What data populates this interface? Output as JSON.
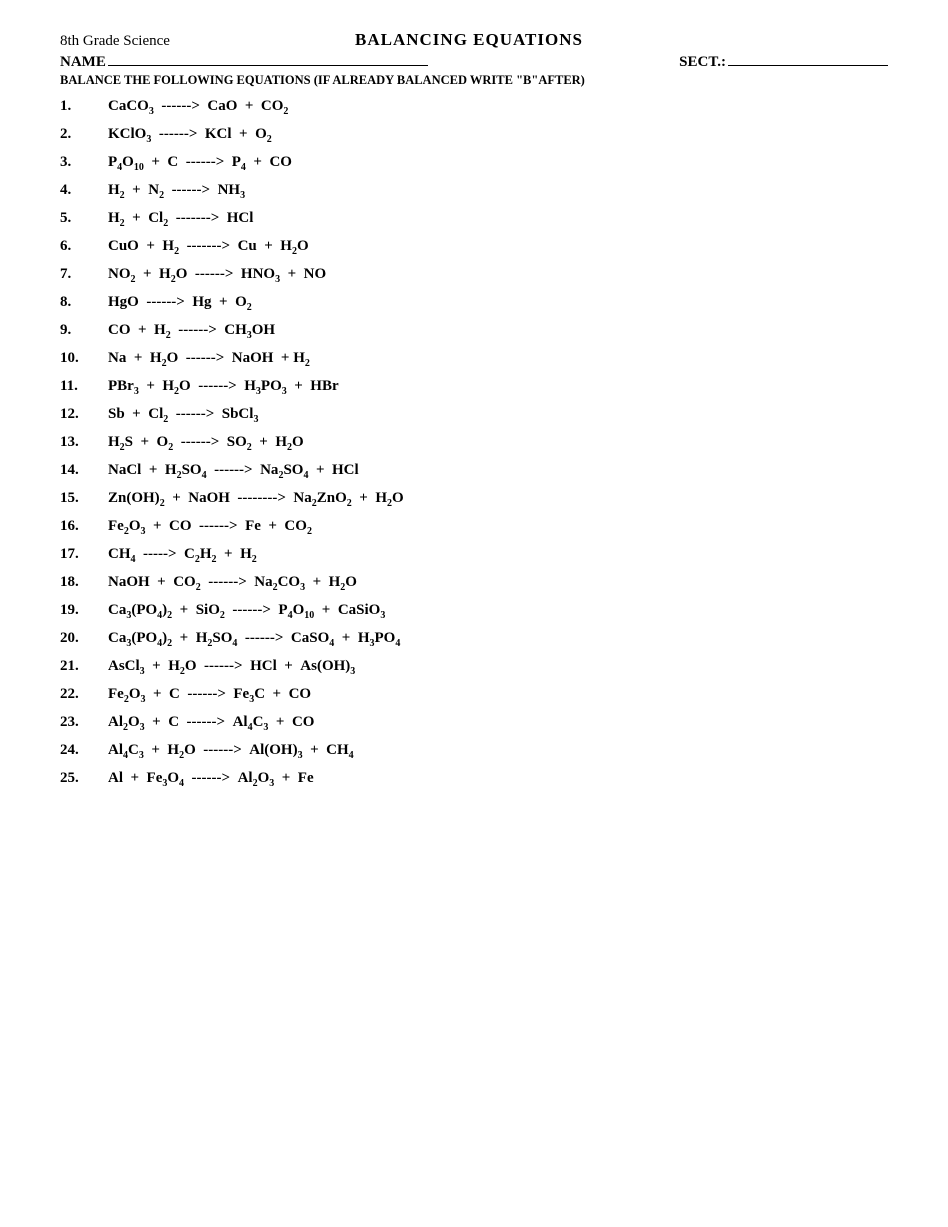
{
  "header": {
    "subject": "8th Grade Science",
    "title": "BALANCING EQUATIONS"
  },
  "form": {
    "name_label": "NAME",
    "sect_label": "SECT.:",
    "instruction": "BALANCE THE FOLLOWING EQUATIONS (IF ALREADY BALANCED WRITE \"B\"AFTER)"
  },
  "equations": [
    {
      "num": "1.",
      "html": "CaCO<sub>3</sub> &nbsp;------&gt; &nbsp;CaO &nbsp;+ &nbsp;CO<sub>2</sub>"
    },
    {
      "num": "2.",
      "html": "KClO<sub>3</sub> &nbsp;------&gt; &nbsp;KCl &nbsp;+ &nbsp;O<sub>2</sub>"
    },
    {
      "num": "3.",
      "html": "P<sub>4</sub>O<sub>10</sub> &nbsp;+ &nbsp;C &nbsp;------&gt; &nbsp;P<sub>4</sub> &nbsp;+ &nbsp;CO"
    },
    {
      "num": "4.",
      "html": "H<sub>2</sub> &nbsp;+ &nbsp;N<sub>2</sub> &nbsp;------&gt; &nbsp;NH<sub>3</sub>"
    },
    {
      "num": "5.",
      "html": "H<sub>2</sub> &nbsp;+ &nbsp;Cl<sub>2</sub> &nbsp;-------&gt; &nbsp;HCl"
    },
    {
      "num": "6.",
      "html": "CuO &nbsp;+ &nbsp;H<sub>2</sub> &nbsp;-------&gt; &nbsp;Cu &nbsp;+ &nbsp;H<sub>2</sub>O"
    },
    {
      "num": "7.",
      "html": "NO<sub>2</sub> &nbsp;+ &nbsp;H<sub>2</sub>O &nbsp;------&gt; &nbsp;HNO<sub>3</sub> &nbsp;+ &nbsp;NO"
    },
    {
      "num": "8.",
      "html": "HgO &nbsp;------&gt; &nbsp;Hg &nbsp;+ &nbsp;O<sub>2</sub>"
    },
    {
      "num": "9.",
      "html": "CO &nbsp;+ &nbsp;H<sub>2</sub> &nbsp;------&gt; &nbsp;CH<sub>3</sub>OH"
    },
    {
      "num": "10.",
      "html": "Na &nbsp;+ &nbsp;H<sub>2</sub>O &nbsp;------&gt; &nbsp;NaOH &nbsp;+ H<sub>2</sub>"
    },
    {
      "num": "11.",
      "html": "PBr<sub>3</sub> &nbsp;+ &nbsp;H<sub>2</sub>O &nbsp;------&gt; &nbsp;H<sub>3</sub>PO<sub>3</sub> &nbsp;+ &nbsp;HBr"
    },
    {
      "num": "12.",
      "html": "Sb &nbsp;+ &nbsp;Cl<sub>2</sub> &nbsp;------&gt; &nbsp;SbCl<sub>3</sub>"
    },
    {
      "num": "13.",
      "html": "H<sub>2</sub>S &nbsp;+ &nbsp;O<sub>2</sub> &nbsp;------&gt; &nbsp;SO<sub>2</sub> &nbsp;+ &nbsp;H<sub>2</sub>O"
    },
    {
      "num": "14.",
      "html": "NaCl &nbsp;+ &nbsp;H<sub>2</sub>SO<sub>4</sub> &nbsp;------&gt; &nbsp;Na<sub>2</sub>SO<sub>4</sub> &nbsp;+ &nbsp;HCl"
    },
    {
      "num": "15.",
      "html": "Zn(OH)<sub>2</sub> &nbsp;+ &nbsp;NaOH &nbsp;--------&gt; &nbsp;Na<sub>2</sub>ZnO<sub>2</sub> &nbsp;+ &nbsp;H<sub>2</sub>O"
    },
    {
      "num": "16.",
      "html": "Fe<sub>2</sub>O<sub>3</sub> &nbsp;+ &nbsp;CO &nbsp;------&gt; &nbsp;Fe &nbsp;+ &nbsp;CO<sub>2</sub>"
    },
    {
      "num": "17.",
      "html": "CH<sub>4</sub> &nbsp;-----&gt; &nbsp;C<sub>2</sub>H<sub>2</sub> &nbsp;+ &nbsp;H<sub>2</sub>"
    },
    {
      "num": "18.",
      "html": "NaOH &nbsp;+ &nbsp;CO<sub>2</sub> &nbsp;------&gt; &nbsp;Na<sub>2</sub>CO<sub>3</sub> &nbsp;+ &nbsp;H<sub>2</sub>O"
    },
    {
      "num": "19.",
      "html": "Ca<sub>3</sub>(PO<sub>4</sub>)<sub>2</sub> &nbsp;+ &nbsp;SiO<sub>2</sub> &nbsp;------&gt; &nbsp;P<sub>4</sub>O<sub>10</sub> &nbsp;+ &nbsp;CaSiO<sub>3</sub>"
    },
    {
      "num": "20.",
      "html": "Ca<sub>3</sub>(PO<sub>4</sub>)<sub>2</sub> &nbsp;+ &nbsp;H<sub>2</sub>SO<sub>4</sub> &nbsp;------&gt; &nbsp;CaSO<sub>4</sub> &nbsp;+ &nbsp;H<sub>3</sub>PO<sub>4</sub>"
    },
    {
      "num": "21.",
      "html": "AsCl<sub>3</sub> &nbsp;+ &nbsp;H<sub>2</sub>O &nbsp;------&gt; &nbsp;HCl &nbsp;+ &nbsp;As(OH)<sub>3</sub>"
    },
    {
      "num": "22.",
      "html": "Fe<sub>2</sub>O<sub>3</sub> &nbsp;+ &nbsp;C &nbsp;------&gt; &nbsp;Fe<sub>3</sub>C &nbsp;+ &nbsp;CO"
    },
    {
      "num": "23.",
      "html": "Al<sub>2</sub>O<sub>3</sub> &nbsp;+ &nbsp;C &nbsp;------&gt; &nbsp;Al<sub>4</sub>C<sub>3</sub> &nbsp;+ &nbsp;CO"
    },
    {
      "num": "24.",
      "html": "Al<sub>4</sub>C<sub>3</sub> &nbsp;+ &nbsp;H<sub>2</sub>O &nbsp;------&gt; &nbsp;Al(OH)<sub>3</sub> &nbsp;+ &nbsp;CH<sub>4</sub>"
    },
    {
      "num": "25.",
      "html": "Al &nbsp;+ &nbsp;Fe<sub>3</sub>O<sub>4</sub> &nbsp;------&gt; &nbsp;Al<sub>2</sub>O<sub>3</sub> &nbsp;+ &nbsp;Fe"
    }
  ]
}
